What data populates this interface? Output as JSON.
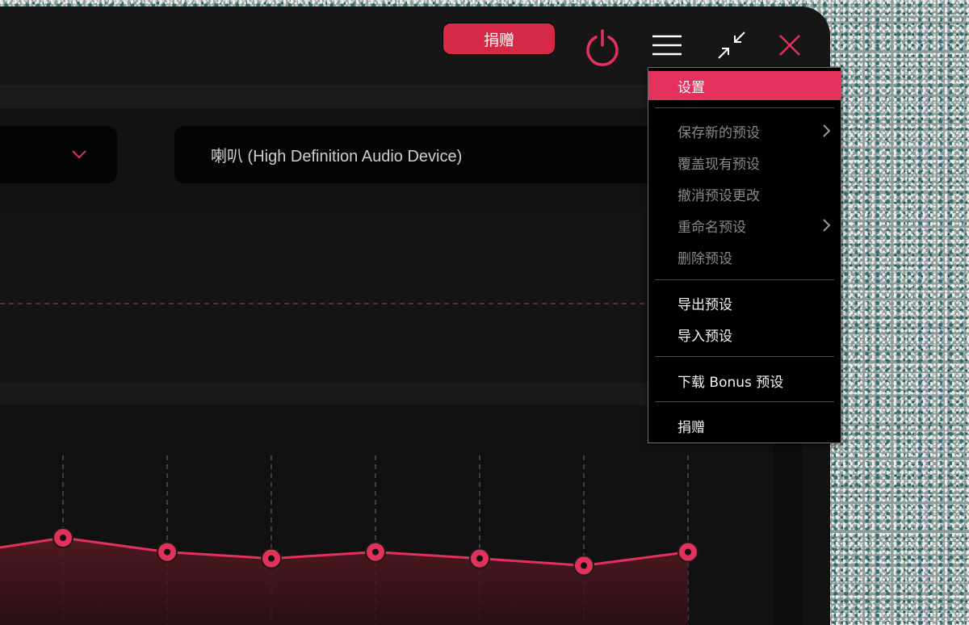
{
  "titlebar": {
    "donate_label": "捐赠",
    "icons": [
      "power-icon",
      "hamburger-menu-icon",
      "minimize-arrows-icon",
      "close-icon"
    ],
    "accent_color": "#e3305c"
  },
  "selectors": {
    "preset_value": "",
    "device_value": "喇叭 (High Definition Audio Device)"
  },
  "menu": {
    "items": [
      {
        "label": "设置",
        "state": "active"
      },
      {
        "label": "保存新的预设",
        "state": "disabled",
        "submenu": true
      },
      {
        "label": "覆盖现有预设",
        "state": "disabled"
      },
      {
        "label": "撤消预设更改",
        "state": "disabled"
      },
      {
        "label": "重命名预设",
        "state": "disabled",
        "submenu": true
      },
      {
        "label": "删除预设",
        "state": "disabled"
      },
      {
        "label": "导出预设",
        "state": "enabled"
      },
      {
        "label": "导入预设",
        "state": "enabled"
      },
      {
        "label": "下载 Bonus 预设",
        "state": "enabled"
      },
      {
        "label": "捐赠",
        "state": "enabled"
      }
    ]
  },
  "eq": {
    "band_count": 7,
    "band_gain_levels": [
      0.3,
      0.52,
      0.62,
      0.52,
      0.62,
      0.73,
      0.52
    ]
  }
}
